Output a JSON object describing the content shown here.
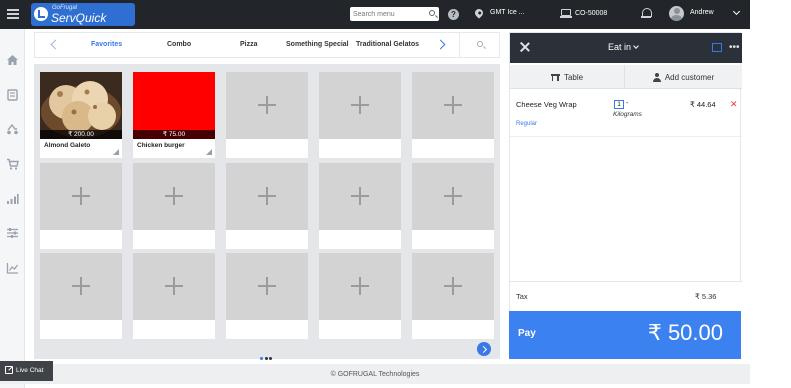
{
  "topbar": {
    "brand_small": "GoFrugal",
    "brand_main": "ServQuick",
    "search_placeholder": "Search menu",
    "timezone_label": "GMT Ice ...",
    "register_label": "CO-50008",
    "user_name": "Andrew"
  },
  "icons": {
    "menu": "hamburger-icon",
    "help": "help-icon",
    "location": "pin-icon",
    "register": "register-icon",
    "notifications": "bell-icon",
    "help_glyph": "?"
  },
  "categories": {
    "tabs": [
      "Favorites",
      "Combo",
      "Pizza",
      "Something Special",
      "Traditional Gelatos"
    ],
    "active": "Favorites"
  },
  "products": [
    {
      "name": "Almond Galeto",
      "price": "₹ 200.00"
    },
    {
      "name": "Chicken burger",
      "price": "₹ 75.00"
    }
  ],
  "empty_slots": 13,
  "order": {
    "mode": "Eat in",
    "tabs": {
      "table": "Table",
      "customer": "Add customer"
    },
    "items": [
      {
        "name": "Cheese Veg Wrap",
        "qty": "1",
        "dash": "-",
        "unit": "Kilograms",
        "price": "₹ 44.64",
        "modifier": "Regular",
        "remove": "✕"
      }
    ],
    "tax_label": "Tax",
    "tax_value": "₹ 5.36",
    "pay_label": "Pay",
    "pay_amount": "₹ 50.00"
  },
  "footer": {
    "copyright": "© GOFRUGAL Technologies"
  },
  "livechat": {
    "label": "Live Chat"
  },
  "colors": {
    "accent": "#3b78e7",
    "topbar": "#22262b",
    "pay": "#3b82f0",
    "remove": "#e53935",
    "chicken_tile": "#ff0000"
  }
}
